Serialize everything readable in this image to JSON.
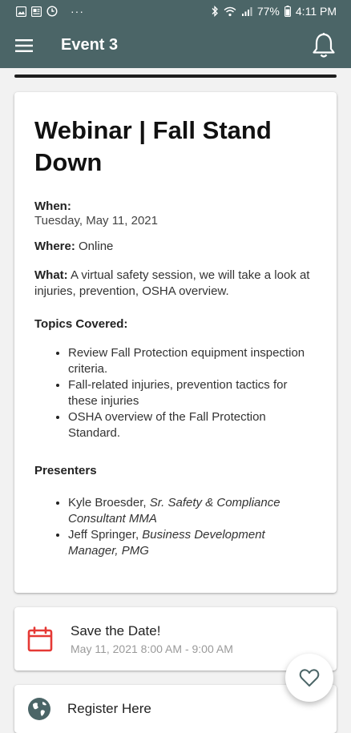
{
  "status_bar": {
    "battery": "77%",
    "time": "4:11 PM",
    "overflow": "···"
  },
  "app_bar": {
    "title": "Event 3"
  },
  "event": {
    "title": "Webinar | Fall Stand Down",
    "when_label": "When:",
    "when_value": "Tuesday, May 11, 2021",
    "where_label": "Where:",
    "where_value": "Online",
    "what_label": "What:",
    "what_value": "A virtual safety session, we will take a look at injuries, prevention, OSHA overview.",
    "topics_label": "Topics Covered:",
    "topics": [
      "Review Fall Protection equipment inspection criteria.",
      "Fall-related injuries, prevention tactics for these injuries",
      "OSHA overview of the Fall Protection Standard."
    ],
    "presenters_label": "Presenters",
    "presenters": [
      {
        "name": "Kyle Broesder,",
        "role": "Sr. Safety & Compliance Consultant MMA"
      },
      {
        "name": "Jeff Springer,",
        "role": "Business Development Manager, PMG"
      }
    ]
  },
  "save_date": {
    "title": "Save the Date!",
    "range": "May 11, 2021 8:00 AM - 9:00 AM",
    "icon": "calendar-icon",
    "icon_color": "#e53935"
  },
  "register": {
    "label": "Register Here",
    "icon": "globe-icon",
    "icon_color": "#4b6567"
  },
  "colors": {
    "app_bar": "#4b6567",
    "background": "#f2f2f2"
  }
}
